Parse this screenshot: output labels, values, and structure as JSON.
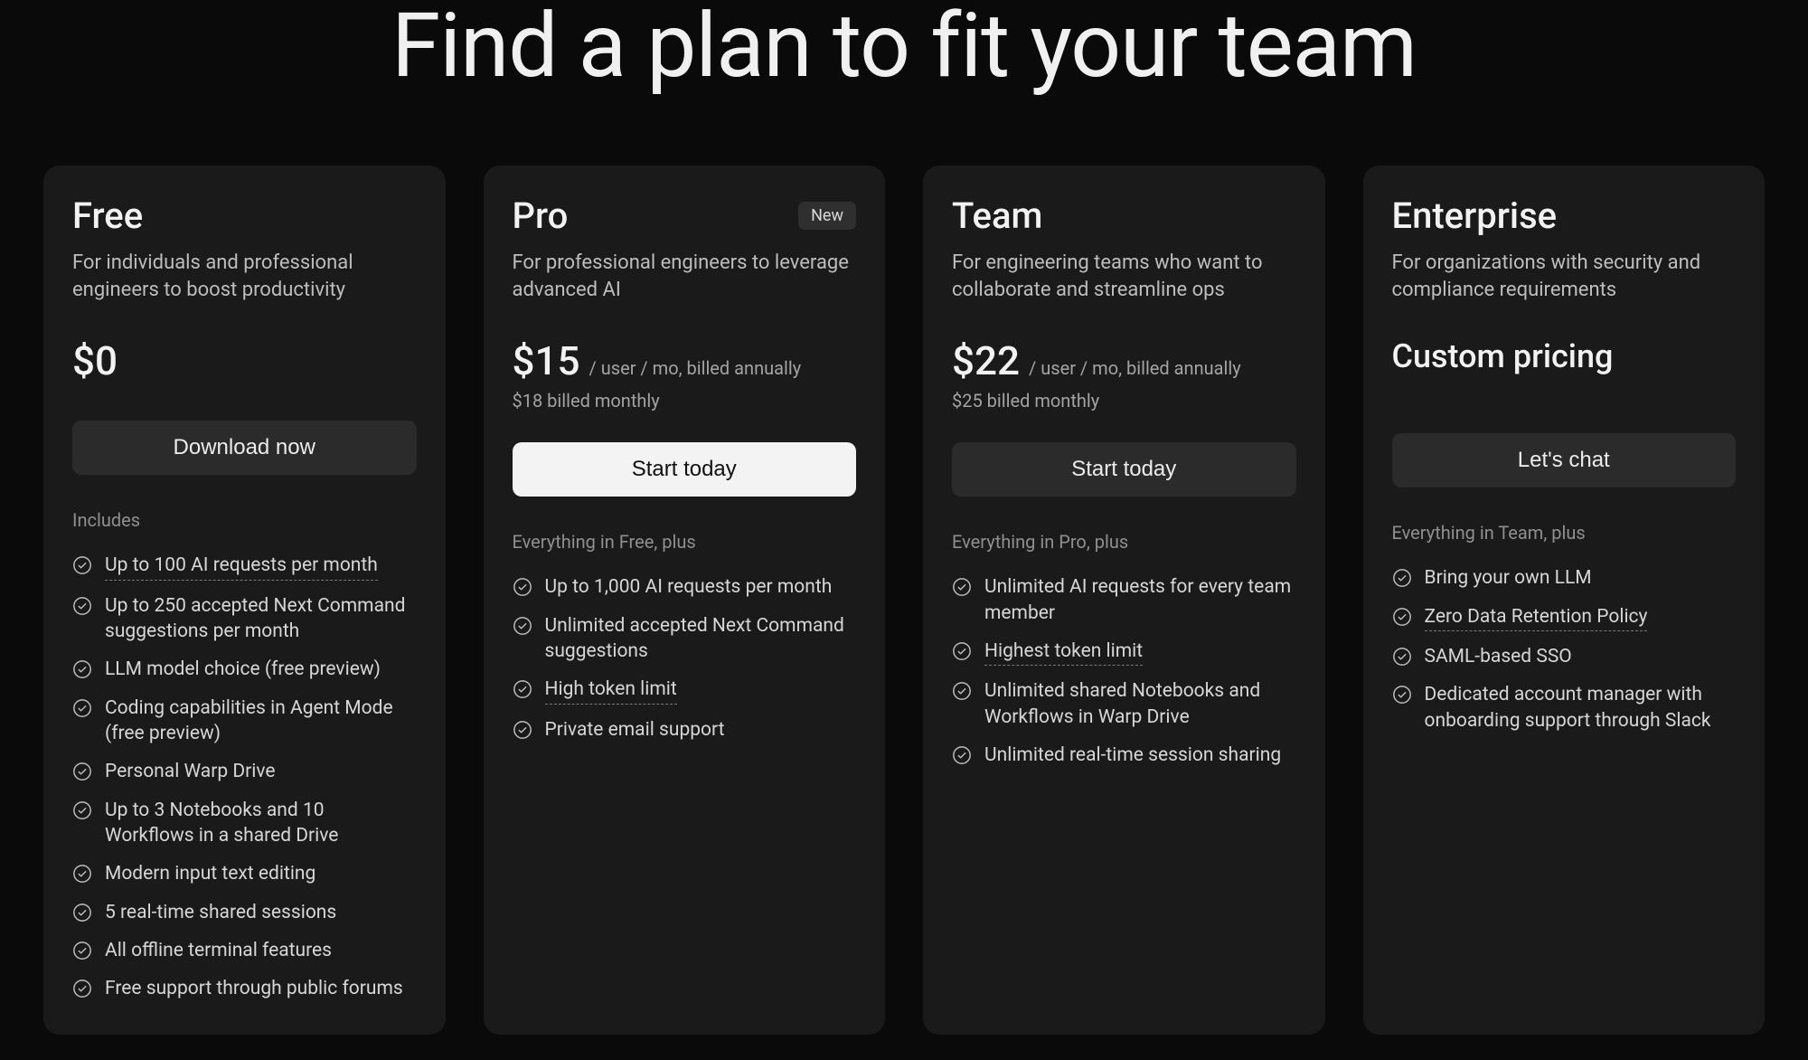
{
  "heading": "Find a plan to fit your team",
  "plans": [
    {
      "name": "Free",
      "tagline": "For individuals and professional engineers to boost productivity",
      "price": "$0",
      "price_unit": "",
      "price_sub": "",
      "cta": "Download now",
      "cta_style": "dark",
      "features_heading": "Includes",
      "features": [
        {
          "text": "Up to 100 AI requests per month",
          "u": true
        },
        {
          "text": "Up to 250 accepted Next Command suggestions per month",
          "u": false
        },
        {
          "text": "LLM model choice (free preview)",
          "u": false
        },
        {
          "text": "Coding capabilities in Agent Mode (free preview)",
          "u": false
        },
        {
          "text": "Personal Warp Drive",
          "u": false
        },
        {
          "text": "Up to 3 Notebooks and 10 Workflows in a shared Drive",
          "u": false
        },
        {
          "text": "Modern input text editing",
          "u": false
        },
        {
          "text": "5 real-time shared sessions",
          "u": false
        },
        {
          "text": "All offline terminal features",
          "u": false
        },
        {
          "text": "Free support through public forums",
          "u": false
        }
      ]
    },
    {
      "name": "Pro",
      "badge": "New",
      "tagline": "For professional engineers to leverage advanced AI",
      "price": "$15",
      "price_unit": "/ user / mo, billed annually",
      "price_sub": "$18 billed monthly",
      "cta": "Start today",
      "cta_style": "light",
      "features_heading": "Everything in Free, plus",
      "features": [
        {
          "text": "Up to 1,000 AI requests per month",
          "u": false
        },
        {
          "text": "Unlimited accepted Next Command suggestions",
          "u": false
        },
        {
          "text": "High token limit",
          "u": true
        },
        {
          "text": "Private email support",
          "u": false
        }
      ]
    },
    {
      "name": "Team",
      "tagline": "For engineering teams who want to collaborate and streamline ops",
      "price": "$22",
      "price_unit": "/ user / mo, billed annually",
      "price_sub": "$25 billed monthly",
      "cta": "Start today",
      "cta_style": "dark",
      "features_heading": "Everything in Pro, plus",
      "features": [
        {
          "text": "Unlimited AI requests for every team member",
          "u": false
        },
        {
          "text": "Highest token limit",
          "u": true
        },
        {
          "text": "Unlimited shared Notebooks and Workflows in Warp Drive",
          "u": false
        },
        {
          "text": "Unlimited real-time session sharing",
          "u": false
        }
      ]
    },
    {
      "name": "Enterprise",
      "tagline": "For organizations with security and compliance requirements",
      "price_custom": "Custom pricing",
      "cta": "Let's chat",
      "cta_style": "dark",
      "features_heading": "Everything in Team, plus",
      "features": [
        {
          "text": "Bring your own LLM",
          "u": false
        },
        {
          "text": "Zero Data Retention Policy",
          "u": true
        },
        {
          "text": "SAML-based SSO",
          "u": false
        },
        {
          "text": "Dedicated account manager with onboarding support through Slack",
          "u": false
        }
      ]
    }
  ]
}
